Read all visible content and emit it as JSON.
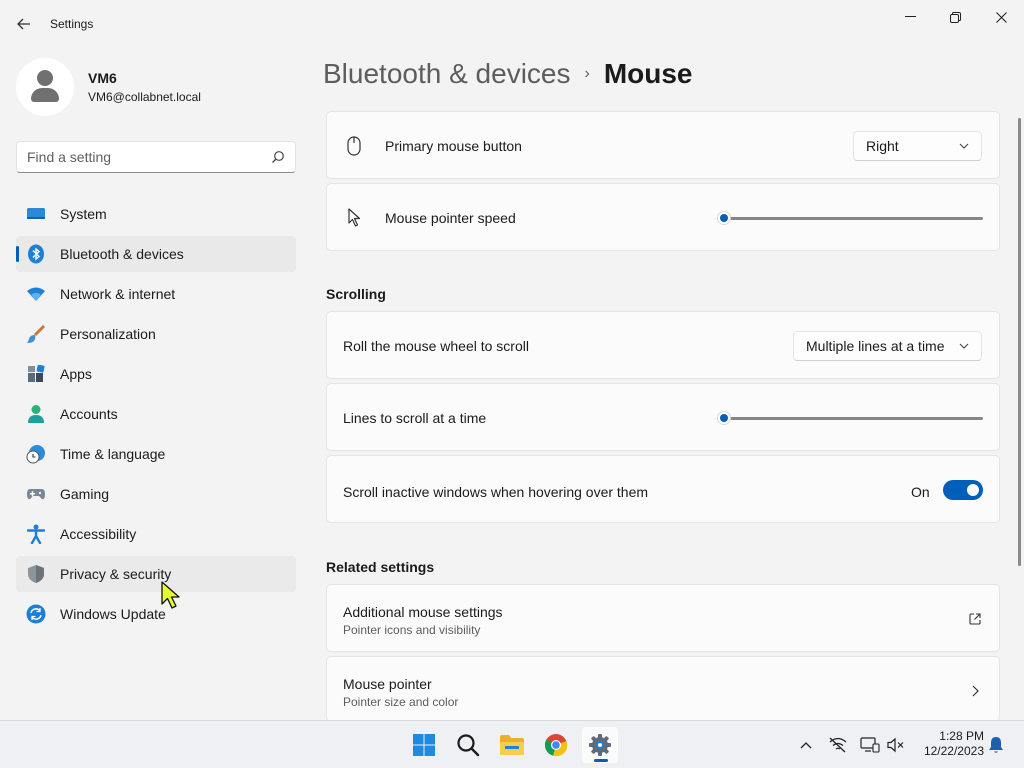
{
  "window": {
    "title": "Settings",
    "minimize": "—",
    "maximize": "❐",
    "close": "✕"
  },
  "profile": {
    "name": "VM6",
    "email": "VM6@collabnet.local"
  },
  "search": {
    "placeholder": "Find a setting"
  },
  "sidebar": {
    "items": [
      {
        "label": "System",
        "icon": "system-icon"
      },
      {
        "label": "Bluetooth & devices",
        "icon": "bluetooth-icon",
        "selected": true
      },
      {
        "label": "Network & internet",
        "icon": "wifi-icon"
      },
      {
        "label": "Personalization",
        "icon": "brush-icon"
      },
      {
        "label": "Apps",
        "icon": "apps-icon"
      },
      {
        "label": "Accounts",
        "icon": "accounts-icon"
      },
      {
        "label": "Time & language",
        "icon": "time-language-icon"
      },
      {
        "label": "Gaming",
        "icon": "gamepad-icon"
      },
      {
        "label": "Accessibility",
        "icon": "accessibility-icon"
      },
      {
        "label": "Privacy & security",
        "icon": "shield-icon",
        "hovered": true
      },
      {
        "label": "Windows Update",
        "icon": "windows-update-icon"
      }
    ]
  },
  "breadcrumb": {
    "parent": "Bluetooth & devices",
    "separator": "›",
    "current": "Mouse"
  },
  "settings": {
    "primary_button": {
      "label": "Primary mouse button",
      "value": "Right"
    },
    "pointer_speed": {
      "label": "Mouse pointer speed",
      "value_fraction": 0.0
    },
    "scrolling_title": "Scrolling",
    "roll_wheel": {
      "label": "Roll the mouse wheel to scroll",
      "value": "Multiple lines at a time"
    },
    "lines_to_scroll": {
      "label": "Lines to scroll at a time",
      "value_fraction": 0.0
    },
    "scroll_inactive": {
      "label": "Scroll inactive windows when hovering over them",
      "state": "On"
    },
    "related_title": "Related settings",
    "additional_mouse": {
      "label": "Additional mouse settings",
      "sub": "Pointer icons and visibility"
    },
    "mouse_pointer": {
      "label": "Mouse pointer",
      "sub": "Pointer size and color"
    }
  },
  "taskbar": {
    "apps": [
      "start-icon",
      "search-icon",
      "file-explorer-icon",
      "chrome-icon",
      "settings-icon"
    ],
    "active_app": "settings-icon",
    "tray": [
      "chevron-up-icon",
      "network-offline-icon",
      "display-icon",
      "volume-muted-icon"
    ],
    "time": "1:28 PM",
    "date": "12/22/2023"
  },
  "colors": {
    "accent": "#005fb8",
    "background": "#f3f3f3",
    "card": "#fbfbfb"
  }
}
